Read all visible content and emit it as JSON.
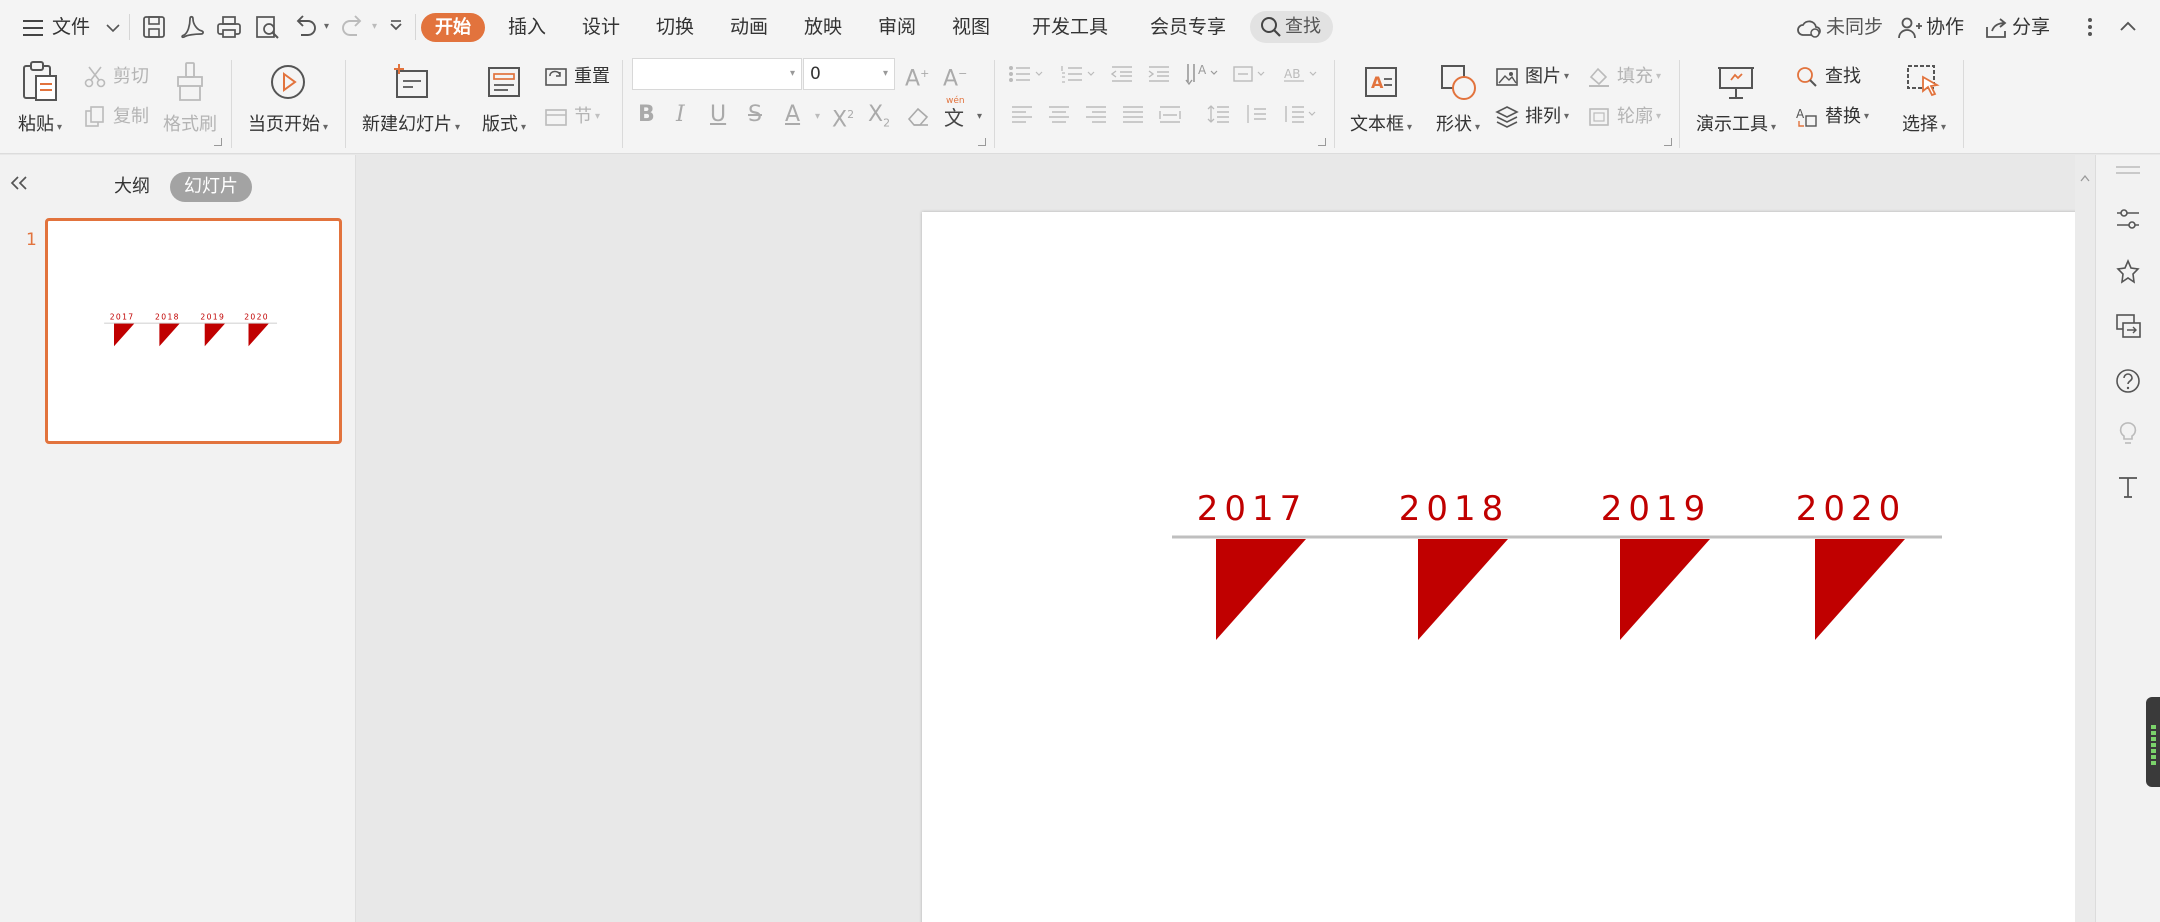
{
  "app_menu": {
    "file_label": "文件"
  },
  "tabs": [
    {
      "label": "开始",
      "active": true
    },
    {
      "label": "插入"
    },
    {
      "label": "设计"
    },
    {
      "label": "切换"
    },
    {
      "label": "动画"
    },
    {
      "label": "放映"
    },
    {
      "label": "审阅"
    },
    {
      "label": "视图"
    },
    {
      "label": "开发工具"
    },
    {
      "label": "会员专享"
    }
  ],
  "search": {
    "label": "查找"
  },
  "top_right": {
    "sync_label": "未同步",
    "collab_label": "协作",
    "share_label": "分享"
  },
  "ribbon": {
    "paste": "粘贴",
    "cut": "剪切",
    "copy": "复制",
    "format_painter": "格式刷",
    "play_from_current": "当页开始",
    "new_slide": "新建幻灯片",
    "layout": "版式",
    "reset": "重置",
    "section": "节",
    "font_name_value": "",
    "font_size_value": "0",
    "text_box": "文本框",
    "shape": "形状",
    "picture": "图片",
    "arrange": "排列",
    "fill": "填充",
    "outline": "轮廓",
    "presentation_tools": "演示工具",
    "find": "查找",
    "replace": "替换",
    "select": "选择"
  },
  "left_panel": {
    "outline_tab": "大纲",
    "slides_tab": "幻灯片",
    "slide_number": "1"
  },
  "slide": {
    "accent_color": "#c00000",
    "line_color": "#bfbfbf",
    "years": [
      "2017",
      "2018",
      "2019",
      "2020"
    ]
  },
  "colors": {
    "brand": "#e2733d",
    "accent": "#c00000"
  }
}
